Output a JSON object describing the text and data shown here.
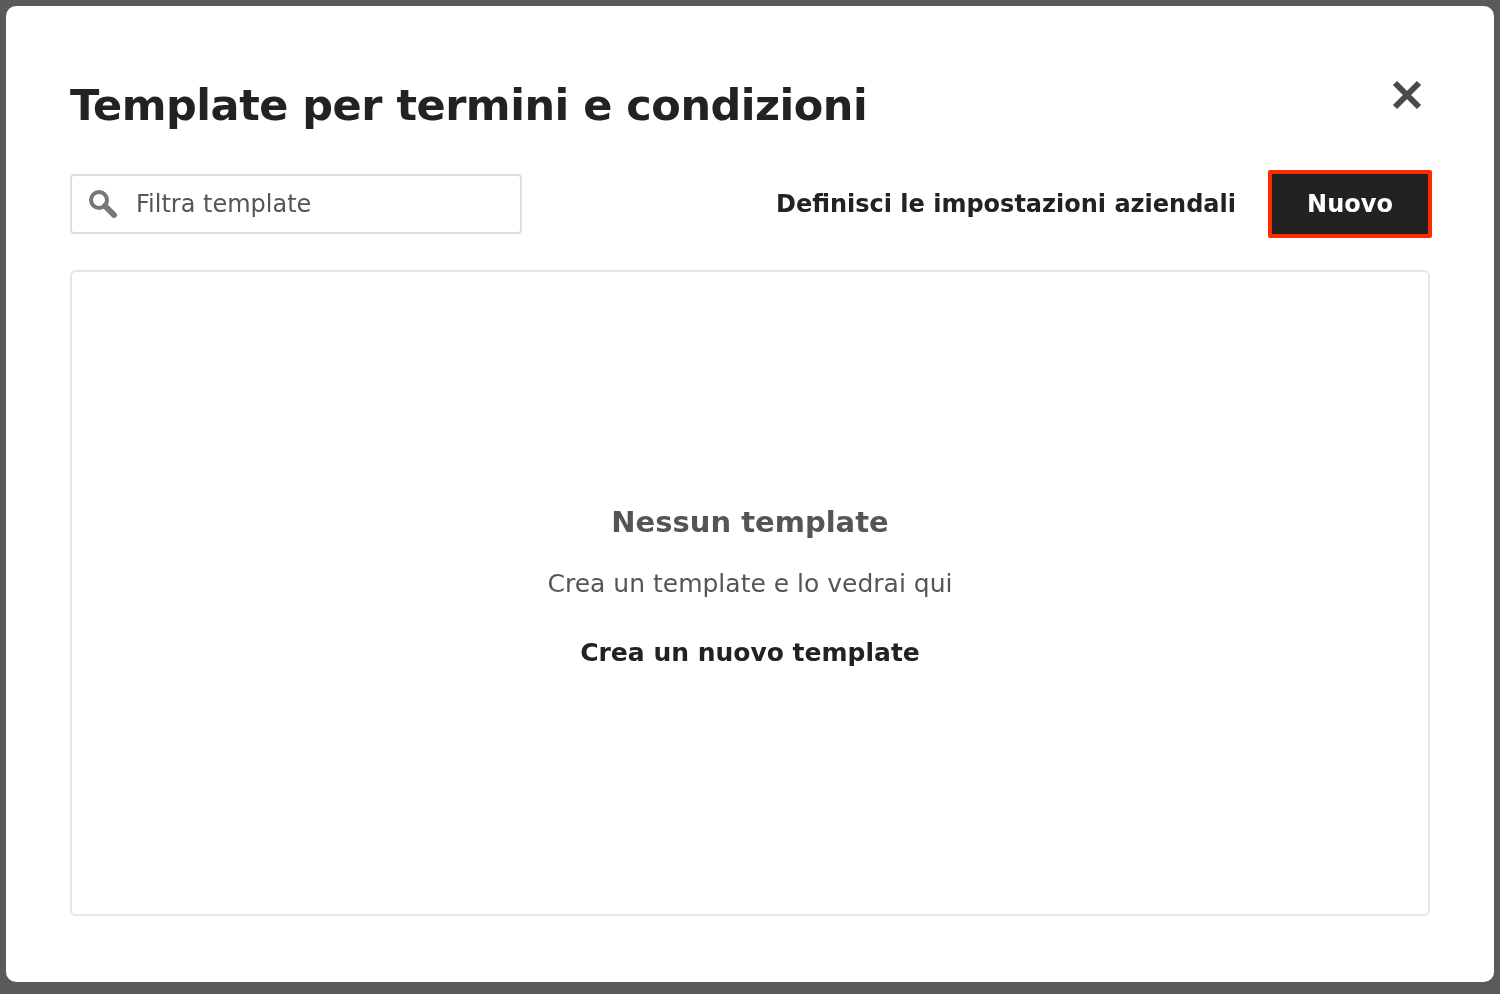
{
  "dialog": {
    "title": "Template per termini e condizioni"
  },
  "search": {
    "placeholder": "Filtra template"
  },
  "settings_link": "Definisci le impostazioni aziendali",
  "new_button": {
    "label": "Nuovo",
    "highlighted": true
  },
  "empty_state": {
    "heading": "Nessun template",
    "message": "Crea un template e lo vedrai qui",
    "action": "Crea un nuovo template"
  }
}
